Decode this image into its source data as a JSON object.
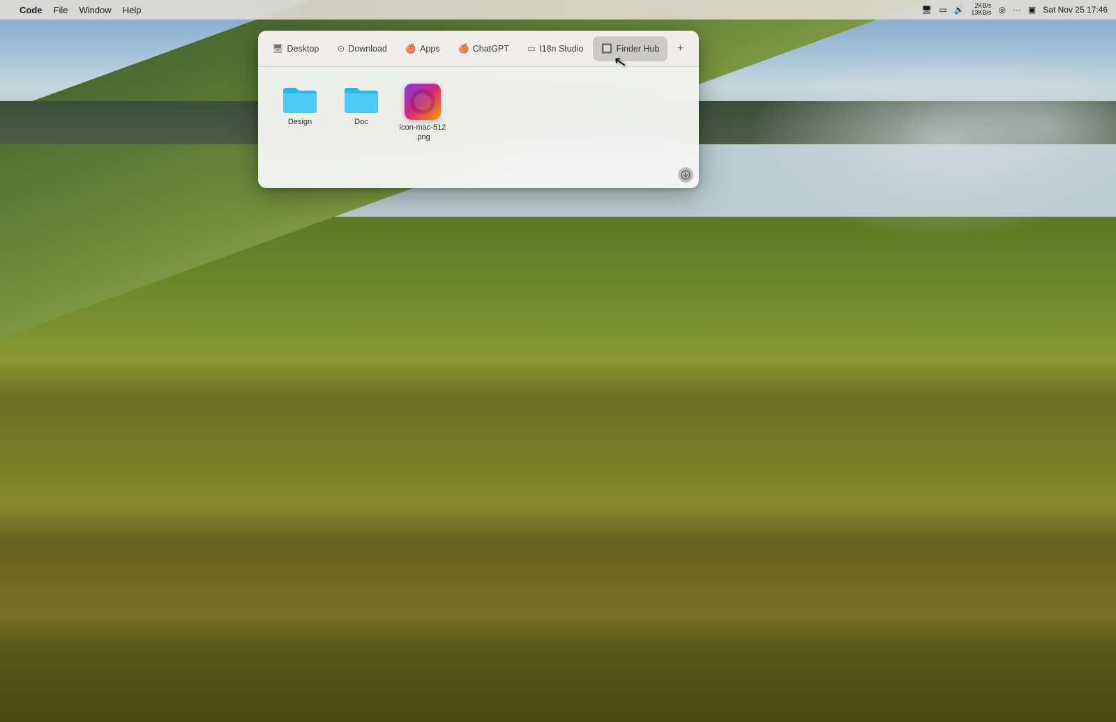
{
  "desktop": {
    "bg_color": "#4a6a2a"
  },
  "menubar": {
    "apple_symbol": "",
    "app_name": "Code",
    "items": [
      "File",
      "Window",
      "Help"
    ],
    "right": {
      "screen_icon": "🖥",
      "battery_icon": "🔋",
      "audio_icon": "🔊",
      "network_up": "2KB/s",
      "network_down": "13KB/s",
      "location_icon": "◎",
      "more_icon": "···",
      "time_machine_icon": "⏱",
      "datetime": "Sat Nov 25  17:46"
    }
  },
  "finder_window": {
    "tabs": [
      {
        "id": "desktop",
        "label": "Desktop",
        "icon": "desktop"
      },
      {
        "id": "download",
        "label": "Download",
        "icon": "download"
      },
      {
        "id": "apps",
        "label": "Apps",
        "icon": "apps"
      },
      {
        "id": "chatgpt",
        "label": "ChatGPT",
        "icon": "chatgpt"
      },
      {
        "id": "i18n_studio",
        "label": "I18n Studio",
        "icon": "i18n"
      },
      {
        "id": "finder_hub",
        "label": "Finder Hub",
        "icon": "finder_hub",
        "active": true
      }
    ],
    "add_tab_label": "+",
    "files": [
      {
        "id": "design",
        "name": "Design",
        "type": "folder",
        "color": "#29b6e8"
      },
      {
        "id": "doc",
        "name": "Doc",
        "type": "folder",
        "color": "#29b6e8"
      },
      {
        "id": "icon_mac",
        "name": "icon-mac-512\n.png",
        "type": "png"
      }
    ],
    "bottom_icon": "↓"
  }
}
